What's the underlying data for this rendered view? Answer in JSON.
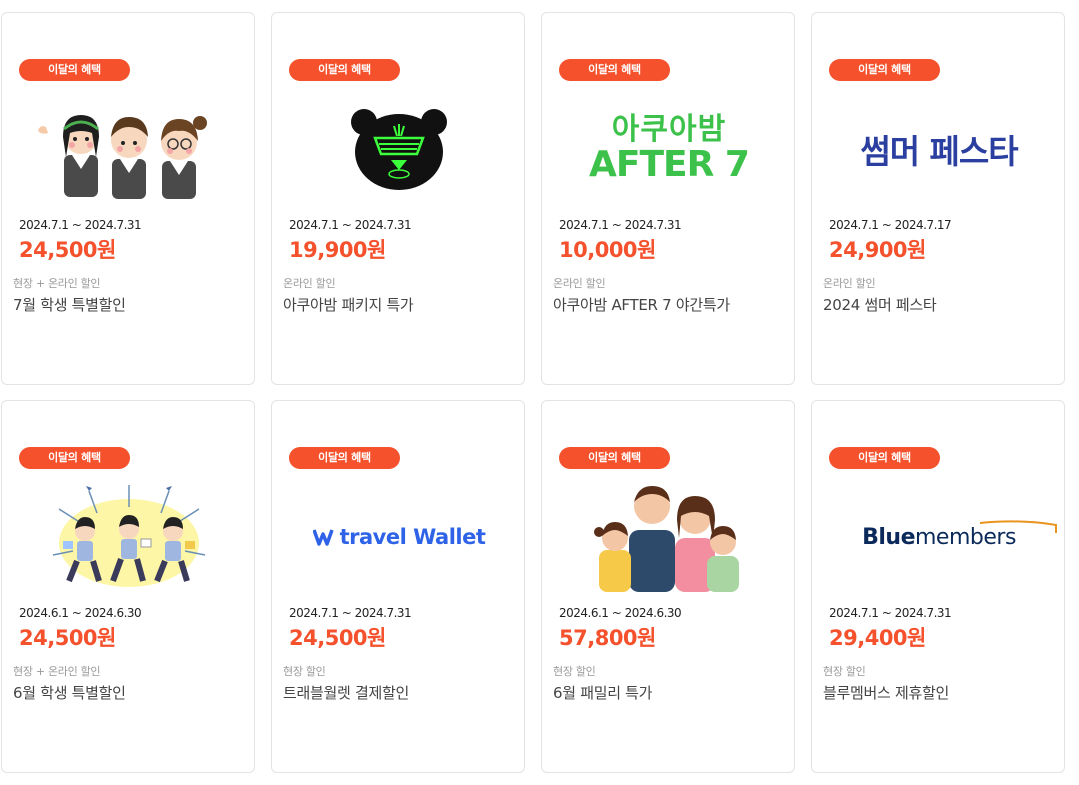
{
  "cards": [
    {
      "badge": "이달의 혜택",
      "date": "2024.7.1 ~ 2024.7.31",
      "price": "24,500원",
      "type": "현장 + 온라인 할인",
      "title": "7월 학생 특별할인",
      "image": "students-illustration"
    },
    {
      "badge": "이달의 혜택",
      "date": "2024.7.1 ~ 2024.7.31",
      "price": "19,900원",
      "type": "온라인 할인",
      "title": "아쿠아밤 패키지 특가",
      "image": "bear-neon-logo"
    },
    {
      "badge": "이달의 혜택",
      "date": "2024.7.1 ~ 2024.7.31",
      "price": "10,000원",
      "type": "온라인 할인",
      "title": "아쿠아밤 AFTER 7 야간특가",
      "image": "after7-logo",
      "logo_line1": "아쿠아밤",
      "logo_line2": "AFTER 7"
    },
    {
      "badge": "이달의 혜택",
      "date": "2024.7.1 ~ 2024.7.17",
      "price": "24,900원",
      "type": "온라인 할인",
      "title": "2024 썸머 페스타",
      "image": "summer-festa-logo",
      "logo": "썸머 페스타"
    },
    {
      "badge": "이달의 혜택",
      "date": "2024.6.1 ~ 2024.6.30",
      "price": "24,500원",
      "type": "현장 + 온라인 할인",
      "title": "6월 학생 특별할인",
      "image": "students-cheer-illustration"
    },
    {
      "badge": "이달의 혜택",
      "date": "2024.7.1 ~ 2024.7.31",
      "price": "24,500원",
      "type": "현장 할인",
      "title": "트래블월렛 결제할인",
      "image": "travel-wallet-logo",
      "logo": "travel Wallet"
    },
    {
      "badge": "이달의 혜택",
      "date": "2024.6.1 ~ 2024.6.30",
      "price": "57,800원",
      "type": "현장 할인",
      "title": "6월 패밀리 특가",
      "image": "family-illustration"
    },
    {
      "badge": "이달의 혜택",
      "date": "2024.7.1 ~ 2024.7.31",
      "price": "29,400원",
      "type": "현장 할인",
      "title": "블루멤버스 제휴할인",
      "image": "bluemembers-logo",
      "logo_part1": "Blue",
      "logo_part2": "members"
    }
  ],
  "colors": {
    "accent": "#f4512c",
    "neon_green": "#3cc24a",
    "summer_blue": "#2b3fa0",
    "bluemembers_navy": "#0b2a5b",
    "travel_blue": "#2e63e8"
  }
}
